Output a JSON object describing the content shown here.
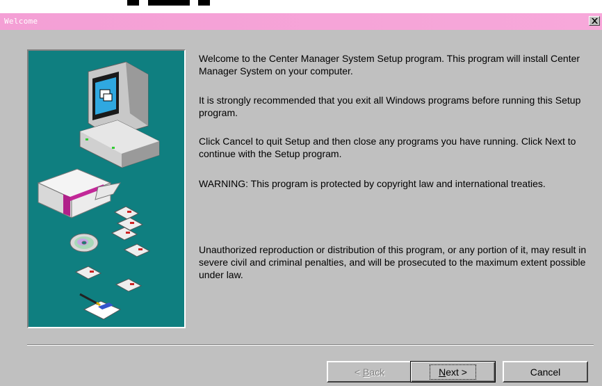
{
  "window": {
    "title": "Welcome",
    "close_glyph": "✕",
    "titlebar_color": "#f49fd5"
  },
  "illustration": {
    "background_color": "#0f7f80",
    "icons": [
      "computer-icon",
      "open-box-icon",
      "floppy-disk-icon",
      "cd-disc-icon",
      "license-card-icon"
    ]
  },
  "content": {
    "paragraphs": [
      "Welcome to the Center Manager System Setup program. This program will install Center Manager System on your computer.",
      "It is strongly recommended that you exit all Windows programs before running this Setup program.",
      "Click Cancel to quit Setup and then close any programs you have running. Click Next to continue with the Setup program.",
      "WARNING: This program is protected by copyright law and international treaties.",
      "Unauthorized reproduction or distribution of this program, or any portion of it, may result in severe civil and criminal penalties, and will be prosecuted to the maximum extent possible under law."
    ]
  },
  "buttons": {
    "back": {
      "prefix": "< ",
      "hotkey": "B",
      "rest": "ack",
      "enabled": false
    },
    "next": {
      "hotkey": "N",
      "rest": "ext >",
      "default": true
    },
    "cancel": {
      "label": "Cancel"
    }
  }
}
